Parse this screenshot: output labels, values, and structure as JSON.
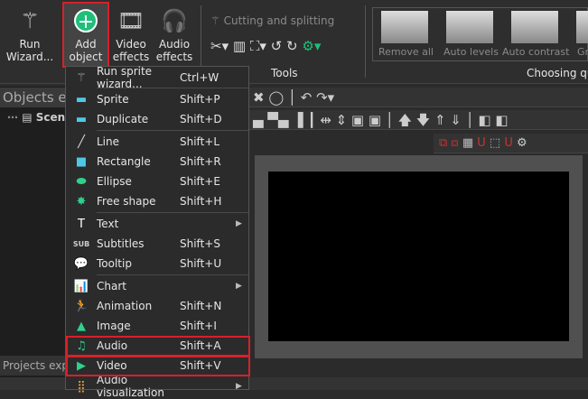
{
  "ribbon": {
    "run_wizard": "Run Wizard...",
    "add_object": "Add object",
    "video_effects": "Video effects",
    "audio_effects": "Audio effects",
    "cutting": "Cutting and splitting",
    "tools": "Tools",
    "quick": {
      "items": [
        "Remove all",
        "Auto levels",
        "Auto contrast",
        "Gr"
      ],
      "group": "Choosing qu"
    }
  },
  "panels": {
    "objects_explorer": "Objects ex",
    "scene": "Scene",
    "projects_explorer": "Projects explo"
  },
  "menu": {
    "items": [
      {
        "label": "Run sprite wizard...",
        "shortcut": "Ctrl+W",
        "icon": "wand-icon"
      },
      {
        "label": "Sprite",
        "shortcut": "Shift+P",
        "icon": "sprite-icon"
      },
      {
        "label": "Duplicate",
        "shortcut": "Shift+D",
        "icon": "duplicate-icon"
      },
      {
        "label": "Line",
        "shortcut": "Shift+L",
        "icon": "line-icon"
      },
      {
        "label": "Rectangle",
        "shortcut": "Shift+R",
        "icon": "rectangle-icon"
      },
      {
        "label": "Ellipse",
        "shortcut": "Shift+E",
        "icon": "ellipse-icon"
      },
      {
        "label": "Free shape",
        "shortcut": "Shift+H",
        "icon": "free-shape-icon"
      },
      {
        "label": "Text",
        "shortcut": "",
        "icon": "text-icon"
      },
      {
        "label": "Subtitles",
        "shortcut": "Shift+S",
        "icon": "subtitles-icon"
      },
      {
        "label": "Tooltip",
        "shortcut": "Shift+U",
        "icon": "tooltip-icon"
      },
      {
        "label": "Chart",
        "shortcut": "",
        "icon": "chart-icon"
      },
      {
        "label": "Animation",
        "shortcut": "Shift+N",
        "icon": "animation-icon"
      },
      {
        "label": "Image",
        "shortcut": "Shift+I",
        "icon": "image-icon"
      },
      {
        "label": "Audio",
        "shortcut": "Shift+A",
        "icon": "audio-icon"
      },
      {
        "label": "Video",
        "shortcut": "Shift+V",
        "icon": "video-icon"
      },
      {
        "label": "Audio visualization",
        "shortcut": "",
        "icon": "audio-visualization-icon"
      }
    ]
  },
  "colors": {
    "highlight": "#d8202a",
    "accent_green": "#1fbf7a"
  }
}
